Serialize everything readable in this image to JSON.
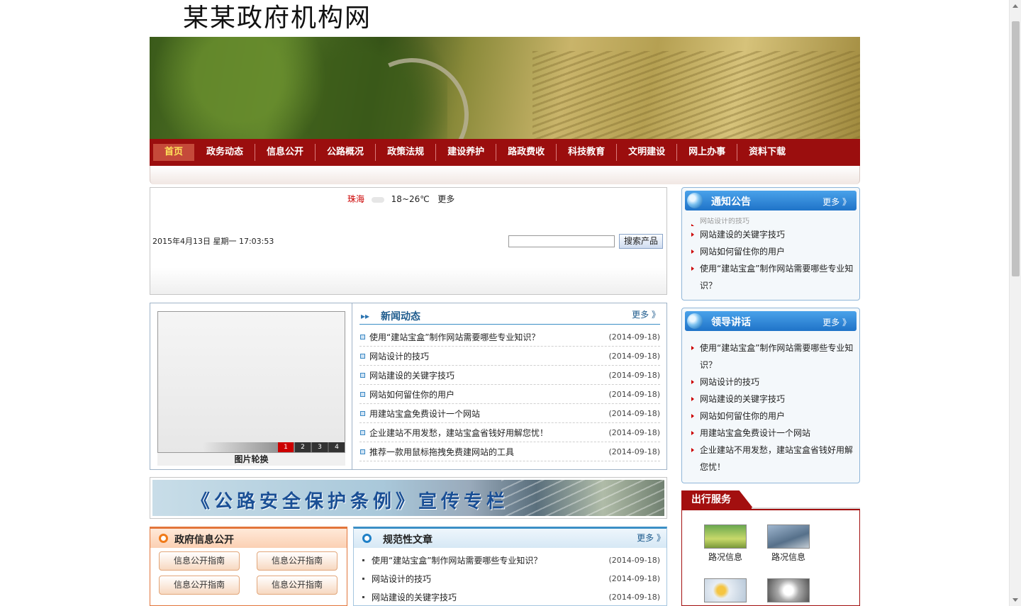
{
  "site": {
    "title": "某某政府机构网"
  },
  "nav": {
    "items": [
      "首页",
      "政务动态",
      "信息公开",
      "公路概况",
      "政策法规",
      "建设养护",
      "路政费收",
      "科技教育",
      "文明建设",
      "网上办事",
      "资料下载"
    ],
    "active_index": 0
  },
  "weather": {
    "city": "珠海",
    "temp": "18~26℃",
    "more": "更多"
  },
  "datetime": "2015年4月13日 星期一 17:03:53",
  "search": {
    "value": "",
    "placeholder": "",
    "button": "搜索产品"
  },
  "slider": {
    "caption": "图片轮换",
    "dots": [
      "1",
      "2",
      "3",
      "4"
    ],
    "active_dot": 0
  },
  "news": {
    "title": "新闻动态",
    "more": "更多 》",
    "items": [
      {
        "text": "使用“建站宝盒”制作网站需要哪些专业知识？",
        "date": "(2014-09-18)"
      },
      {
        "text": "网站设计的技巧",
        "date": "(2014-09-18)"
      },
      {
        "text": "网站建设的关键字技巧",
        "date": "(2014-09-18)"
      },
      {
        "text": "网站如何留住你的用户",
        "date": "(2014-09-18)"
      },
      {
        "text": "用建站宝盒免费设计一个网站",
        "date": "(2014-09-18)"
      },
      {
        "text": "企业建站不用发愁，建站宝盒省钱好用解您忧！",
        "date": "(2014-09-18)"
      },
      {
        "text": "推荐一款用鼠标拖拽免费建网站的工具",
        "date": "(2014-09-18)"
      }
    ]
  },
  "promo": {
    "text": "《公路安全保护条例》宣传专栏"
  },
  "gov_info": {
    "title": "政府信息公开",
    "buttons": [
      "信息公开指南",
      "信息公开指南",
      "信息公开指南",
      "信息公开指南"
    ]
  },
  "rules": {
    "title": "规范性文章",
    "more": "更多 》",
    "items": [
      {
        "text": "使用“建站宝盒”制作网站需要哪些专业知识？",
        "date": "(2014-09-18)"
      },
      {
        "text": "网站设计的技巧",
        "date": "(2014-09-18)"
      },
      {
        "text": "网站建设的关键字技巧",
        "date": "(2014-09-18)"
      }
    ]
  },
  "notices": {
    "title": "通知公告",
    "more": "更多 》",
    "items": [
      "网站设计的技巧",
      "网站建设的关键字技巧",
      "网站如何留住你的用户",
      "使用“建站宝盒”制作网站需要哪些专业知识？"
    ]
  },
  "leaders": {
    "title": "领导讲话",
    "more": "更多 》",
    "items": [
      "使用“建站宝盒”制作网站需要哪些专业知识？",
      "网站设计的技巧",
      "网站建设的关键字技巧",
      "网站如何留住你的用户",
      "用建站宝盒免费设计一个网站",
      "企业建站不用发愁，建站宝盒省钱好用解您忧！"
    ]
  },
  "travel": {
    "title": "出行服务",
    "items": [
      "路况信息",
      "路况信息"
    ]
  },
  "colors": {
    "nav_bg": "#9b0e0e",
    "accent_blue": "#1f73c8",
    "accent_orange": "#e2753a"
  }
}
